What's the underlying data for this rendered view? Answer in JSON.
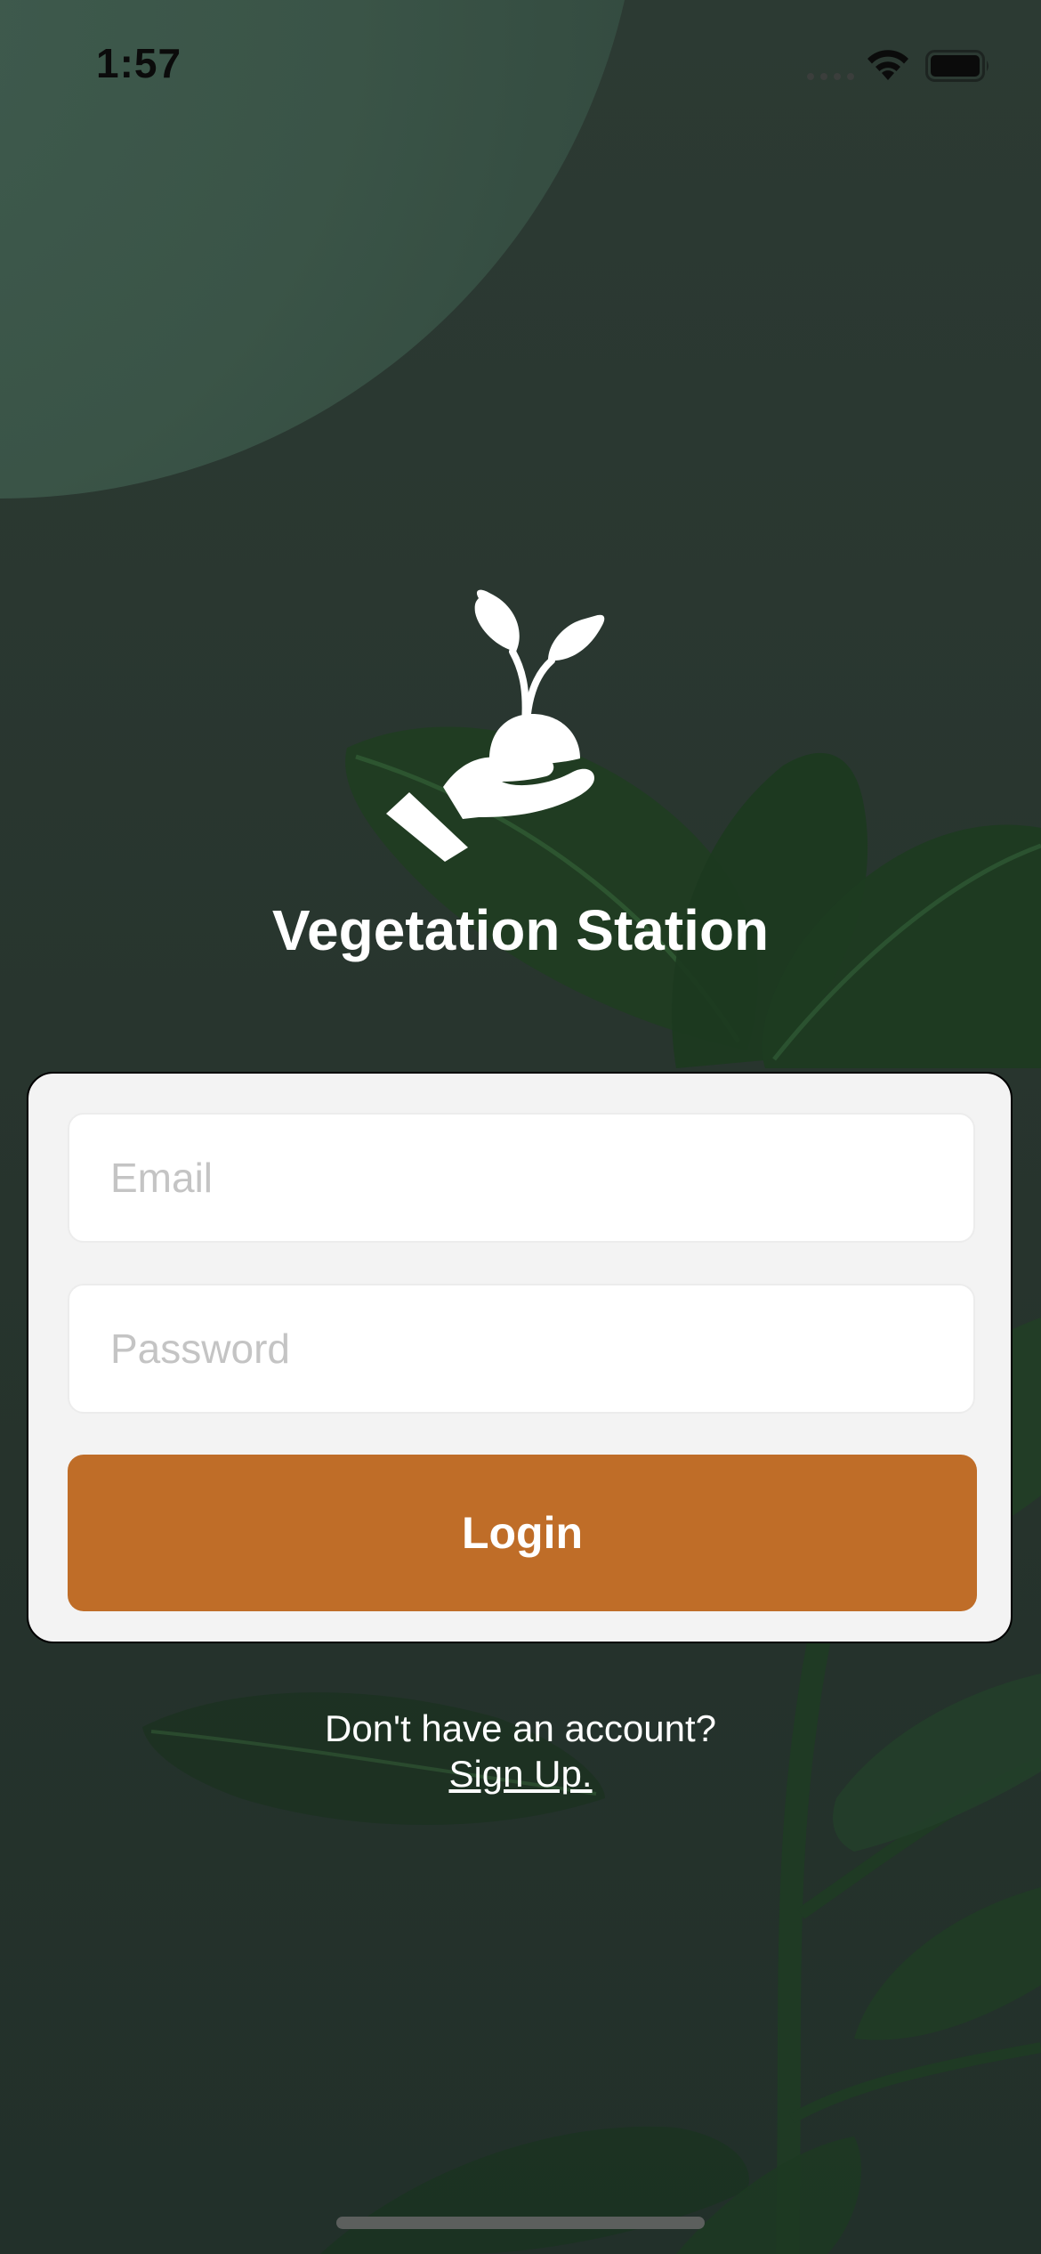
{
  "status_bar": {
    "time": "1:57"
  },
  "app": {
    "title": "Vegetation Station",
    "logo_icon": "hand-holding-seedling-icon"
  },
  "login_form": {
    "email_placeholder": "Email",
    "password_placeholder": "Password",
    "login_label": "Login"
  },
  "signup": {
    "prompt": "Don't have an account?",
    "link_label": "Sign Up."
  },
  "colors": {
    "background": "#2b3832",
    "accent_circle": "#3a5447",
    "card": "#f3f3f3",
    "login_button": "#bf6d28",
    "text_light": "#ffffff",
    "placeholder": "#c4c4c4"
  }
}
